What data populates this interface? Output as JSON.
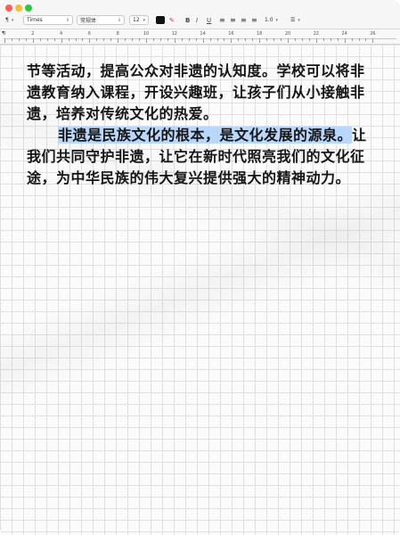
{
  "window": {
    "title": ""
  },
  "toolbar": {
    "paragraph_icon": "¶",
    "font_family": "Times",
    "font_style": "常规体",
    "font_size": "12",
    "text_color": "#111111",
    "bold": "B",
    "italic": "I",
    "underline": "U",
    "line_spacing": "1.0",
    "list_icon": "☰"
  },
  "ruler": {
    "labels": [
      "0",
      "2",
      "4",
      "6",
      "8",
      "10",
      "12",
      "14",
      "16",
      "18",
      "20",
      "22",
      "24",
      "26"
    ]
  },
  "document": {
    "para1": "节等活动，提高公众对非遗的认知度。学校可以将非遗教育纳入课程，开设兴趣班，让孩子们从小接触非遗，培养对传统文化的热爱。",
    "para2_highlight": "非遗是民族文化的根本，是文化发展的源泉。",
    "para2_rest": "让我们共同守护非遗，让它在新时代照亮我们的文化征途，为中华民族的伟大复兴提供强大的精神动力。",
    "highlight_color": "#b9d7fb"
  }
}
